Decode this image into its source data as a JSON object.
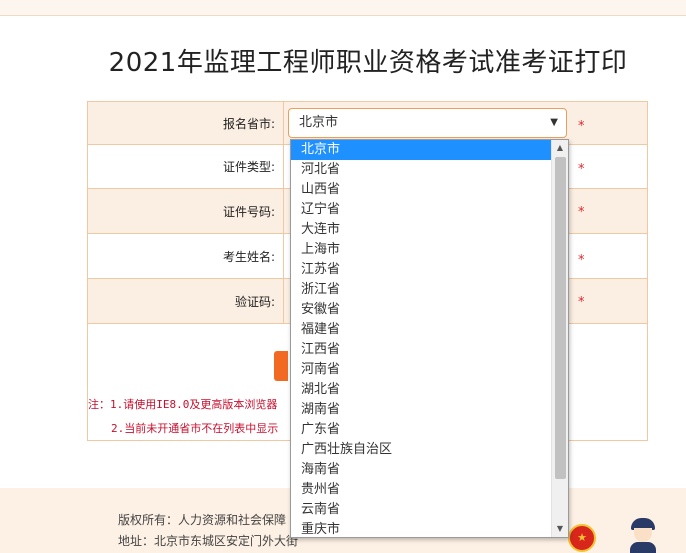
{
  "page_title": "2021年监理工程师职业资格考试准考证打印",
  "form": {
    "province_label": "报名省市:",
    "province_selected": "北京市",
    "id_type_label": "证件类型:",
    "id_number_label": "证件号码:",
    "name_label": "考生姓名:",
    "captcha_label": "验证码:",
    "required_mark": "*"
  },
  "dropdown": {
    "options": [
      "北京市",
      "河北省",
      "山西省",
      "辽宁省",
      "大连市",
      "上海市",
      "江苏省",
      "浙江省",
      "安徽省",
      "福建省",
      "江西省",
      "河南省",
      "湖北省",
      "湖南省",
      "广东省",
      "广西壮族自治区",
      "海南省",
      "贵州省",
      "云南省",
      "重庆市"
    ],
    "selected_index": 0
  },
  "notes": {
    "line1": "注：1.请使用IE8.0及更高版本浏览器",
    "line2": "2.当前未开通省市不在列表中显示"
  },
  "footer": {
    "copyright": "版权所有：人力资源和社会保障",
    "address": "地址：北京市东城区安定门外大街"
  },
  "colors": {
    "accent": "#f26a22",
    "row_alt": "#fbeee2",
    "border": "#f0c9a3",
    "required": "#e0282f",
    "selected_option": "#1e90ff"
  },
  "icons": {
    "select_arrow": "caret-down-icon",
    "emblem": "national-emblem-icon",
    "police": "police-mascot-icon"
  }
}
